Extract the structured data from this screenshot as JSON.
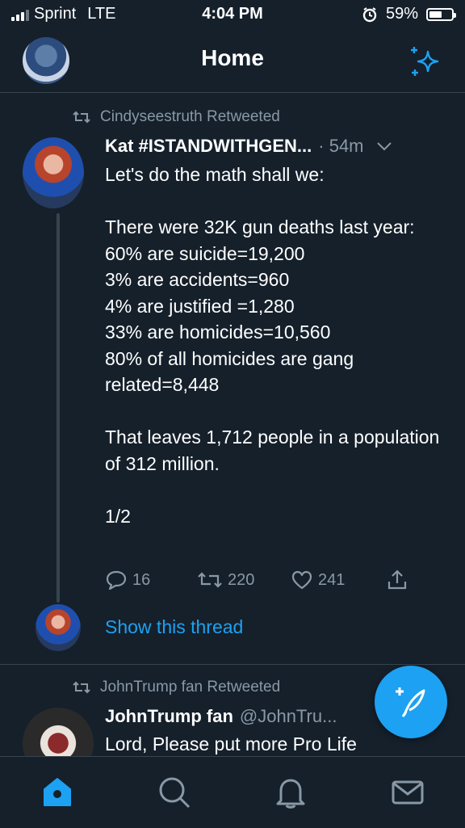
{
  "status_bar": {
    "carrier": "Sprint",
    "network": "LTE",
    "time": "4:04 PM",
    "battery": "59%",
    "battery_level": 0.59
  },
  "nav": {
    "title": "Home",
    "profile_icon": "avatar",
    "right_icon": "sparkle-icon"
  },
  "tweet1": {
    "retweeted_by": "Cindyseestruth Retweeted",
    "name": "Kat  #ISTANDWITHGEN...",
    "meta": "· 54m",
    "lines": [
      "Let's do the math shall we:",
      "",
      "There were 32K gun deaths last year:",
      "60% are suicide=19,200",
      "3% are accidents=960",
      "4% are justified =1,280",
      "33% are homicides=10,560",
      "80% of all homicides are gang related=8,448",
      "",
      "That leaves 1,712 people in a population of 312 million.",
      "",
      "1/2"
    ],
    "replies": "16",
    "retweets": "220",
    "likes": "241",
    "show_thread": "Show this thread"
  },
  "tweet2": {
    "retweeted_by": "JohnTrump fan Retweeted",
    "name": "JohnTrump fan",
    "handle": "@JohnTru...",
    "text": "Lord, Please put more Pro Life"
  },
  "colors": {
    "background": "#15202b",
    "accent": "#1da1f2",
    "muted": "#8899a6",
    "divider": "#38444d"
  },
  "tabs": [
    "home-icon",
    "search-icon",
    "bell-icon",
    "mail-icon"
  ]
}
